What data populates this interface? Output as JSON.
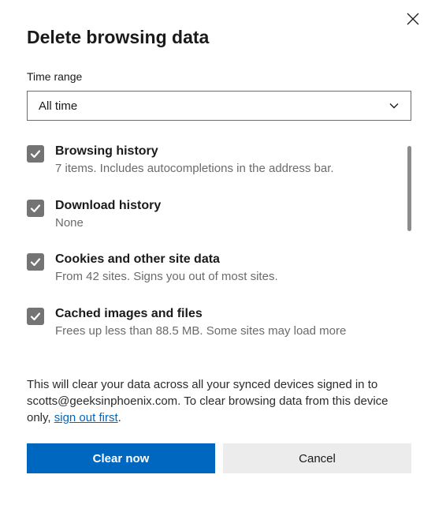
{
  "dialog": {
    "title": "Delete browsing data",
    "time_range_label": "Time range"
  },
  "select": {
    "value": "All time"
  },
  "options": [
    {
      "title": "Browsing history",
      "desc": "7 items. Includes autocompletions in the address bar.",
      "checked": true
    },
    {
      "title": "Download history",
      "desc": "None",
      "checked": true
    },
    {
      "title": "Cookies and other site data",
      "desc": "From 42 sites. Signs you out of most sites.",
      "checked": true
    },
    {
      "title": "Cached images and files",
      "desc": "Frees up less than 88.5 MB. Some sites may load more",
      "checked": true
    }
  ],
  "note": {
    "prefix": "This will clear your data across all your synced devices signed in to scotts@geeksinphoenix.com. To clear browsing data from this device only, ",
    "link": "sign out first",
    "suffix": "."
  },
  "buttons": {
    "primary": "Clear now",
    "secondary": "Cancel"
  }
}
